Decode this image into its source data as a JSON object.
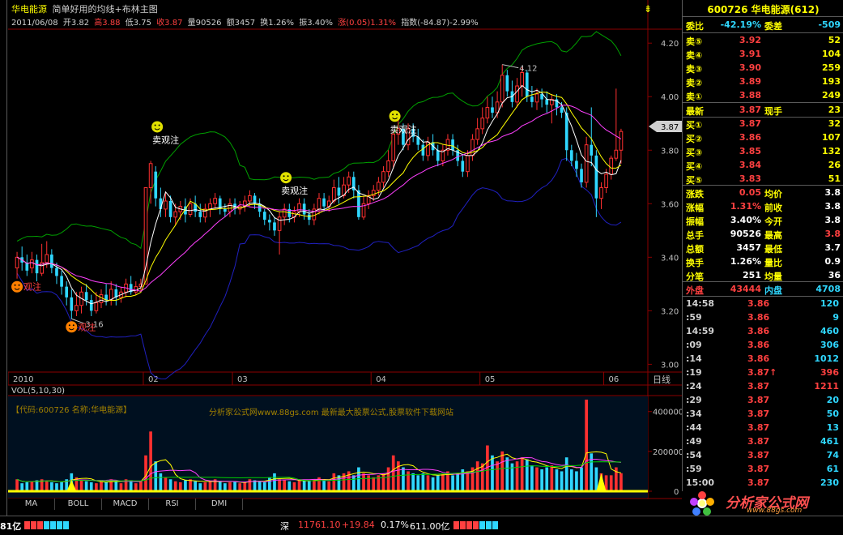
{
  "header": {
    "stock_name": "华电能源",
    "formula_name": "简单好用的均线+布林主图",
    "date": "2011/06/08",
    "open": "开3.82",
    "high": "高3.88",
    "low": "低3.75",
    "close": "收3.87",
    "volume": "量90526",
    "amount": "额3457",
    "turnover": "换1.26%",
    "amplitude": "振3.40%",
    "change": "涨(0.05)1.31%",
    "index": "指数(-84.87)-2.99%"
  },
  "price_axis": [
    "4.20",
    "4.00",
    "3.80",
    "3.60",
    "3.40",
    "3.20",
    "3.00"
  ],
  "current_price_tag": "3.87",
  "time_axis": [
    "2010",
    "02",
    "03",
    "04",
    "05",
    "06"
  ],
  "day_label": "日线",
  "annotations": {
    "high_label": "4.12",
    "low_label": "3.16",
    "sell_label": "卖观注",
    "buy_label": "观注"
  },
  "volume_panel": {
    "label": "VOL(5,10,30)",
    "code_line": "【代码:600726 名称:华电能源】",
    "ad_line": "分析家公式网www.88gs.com 最新最大股票公式,股票软件下载网站",
    "axis": [
      "400000",
      "200000",
      "0"
    ]
  },
  "tabs": [
    "MA",
    "BOLL",
    "MACD",
    "RSI",
    "DMI"
  ],
  "status_bar": {
    "left_fragment": "81亿",
    "market": "深",
    "index_value": "11761.10",
    "index_change": "+19.84",
    "index_pct": "0.17%",
    "index_amount": "611.00亿"
  },
  "panel": {
    "title": "600726 华电能源(612)",
    "ratio_label": "委比",
    "ratio_value": "-42.19%",
    "diff_label": "委差",
    "diff_value": "-509",
    "asks": [
      {
        "label": "卖⑤",
        "price": "3.92",
        "vol": "52"
      },
      {
        "label": "卖④",
        "price": "3.91",
        "vol": "104"
      },
      {
        "label": "卖③",
        "price": "3.90",
        "vol": "259"
      },
      {
        "label": "卖②",
        "price": "3.89",
        "vol": "193"
      },
      {
        "label": "卖①",
        "price": "3.88",
        "vol": "249"
      }
    ],
    "last_label": "最新",
    "last_value": "3.87",
    "hand_label": "现手",
    "hand_value": "23",
    "bids": [
      {
        "label": "买①",
        "price": "3.87",
        "vol": "32"
      },
      {
        "label": "买②",
        "price": "3.86",
        "vol": "107"
      },
      {
        "label": "买③",
        "price": "3.85",
        "vol": "132"
      },
      {
        "label": "买④",
        "price": "3.84",
        "vol": "26"
      },
      {
        "label": "买⑤",
        "price": "3.83",
        "vol": "51"
      }
    ],
    "stats": [
      {
        "l1": "涨跌",
        "v1": "0.05",
        "l2": "均价",
        "v2": "3.8"
      },
      {
        "l1": "涨幅",
        "v1": "1.31%",
        "l2": "前收",
        "v2": "3.8"
      },
      {
        "l1": "振幅",
        "v1": "3.40%",
        "l2": "今开",
        "v2": "3.8"
      },
      {
        "l1": "总手",
        "v1": "90526",
        "l2": "最高",
        "v2": "3.8"
      },
      {
        "l1": "总额",
        "v1": "3457",
        "l2": "最低",
        "v2": "3.7"
      },
      {
        "l1": "换手",
        "v1": "1.26%",
        "l2": "量比",
        "v2": "0.9"
      },
      {
        "l1": "分笔",
        "v1": "251",
        "l2": "均量",
        "v2": "36"
      }
    ],
    "outer_label": "外盘",
    "outer_value": "43444",
    "inner_label": "内盘",
    "inner_value": "4708",
    "ticks": [
      {
        "t": "14:58",
        "p": "3.86",
        "v": "120",
        "c": "#2fd7ff"
      },
      {
        "t": ":59",
        "p": "3.86",
        "v": "9",
        "c": "#2fd7ff"
      },
      {
        "t": "14:59",
        "p": "3.86",
        "v": "460",
        "c": "#2fd7ff"
      },
      {
        "t": ":09",
        "p": "3.86",
        "v": "306",
        "c": "#2fd7ff"
      },
      {
        "t": ":14",
        "p": "3.86",
        "v": "1012",
        "c": "#2fd7ff"
      },
      {
        "t": ":19",
        "p": "3.87↑",
        "v": "396",
        "c": "#ff4040"
      },
      {
        "t": ":24",
        "p": "3.87",
        "v": "1211",
        "c": "#ff4040"
      },
      {
        "t": ":29",
        "p": "3.87",
        "v": "20",
        "c": "#2fd7ff"
      },
      {
        "t": ":34",
        "p": "3.87",
        "v": "50",
        "c": "#2fd7ff"
      },
      {
        "t": ":44",
        "p": "3.87",
        "v": "13",
        "c": "#2fd7ff"
      },
      {
        "t": ":49",
        "p": "3.87",
        "v": "461",
        "c": "#2fd7ff"
      },
      {
        "t": ":54",
        "p": "3.87",
        "v": "74",
        "c": "#2fd7ff"
      },
      {
        "t": ":59",
        "p": "3.87",
        "v": "61",
        "c": "#2fd7ff"
      },
      {
        "t": "15:00",
        "p": "3.87",
        "v": "230",
        "c": "#2fd7ff"
      }
    ]
  },
  "logo": {
    "text": "分析家公式网",
    "url": "www.88gs.com"
  },
  "chart_data": {
    "type": "candlestick",
    "y_range": [
      2.98,
      4.24
    ],
    "volume_range": [
      0,
      460000
    ],
    "candles": [
      [
        3.36,
        3.4,
        3.42,
        3.32,
        60000
      ],
      [
        3.4,
        3.38,
        3.44,
        3.35,
        40000
      ],
      [
        3.38,
        3.35,
        3.41,
        3.33,
        45000
      ],
      [
        3.36,
        3.39,
        3.42,
        3.34,
        50000
      ],
      [
        3.39,
        3.34,
        3.41,
        3.31,
        55000
      ],
      [
        3.34,
        3.38,
        3.45,
        3.33,
        60000
      ],
      [
        3.38,
        3.41,
        3.46,
        3.36,
        50000
      ],
      [
        3.41,
        3.36,
        3.43,
        3.34,
        45000
      ],
      [
        3.36,
        3.33,
        3.38,
        3.3,
        40000
      ],
      [
        3.33,
        3.29,
        3.35,
        3.26,
        45000
      ],
      [
        3.29,
        3.25,
        3.31,
        3.22,
        60000
      ],
      [
        3.25,
        3.2,
        3.28,
        3.17,
        90000
      ],
      [
        3.2,
        3.22,
        3.27,
        3.18,
        70000
      ],
      [
        3.22,
        3.27,
        3.29,
        3.19,
        55000
      ],
      [
        3.27,
        3.24,
        3.3,
        3.22,
        50000
      ],
      [
        3.24,
        3.2,
        3.26,
        3.18,
        45000
      ],
      [
        3.2,
        3.23,
        3.27,
        3.19,
        40000
      ],
      [
        3.23,
        3.26,
        3.28,
        3.21,
        50000
      ],
      [
        3.26,
        3.24,
        3.3,
        3.22,
        45000
      ],
      [
        3.24,
        3.28,
        3.31,
        3.22,
        60000
      ],
      [
        3.28,
        3.25,
        3.3,
        3.22,
        50000
      ],
      [
        3.25,
        3.27,
        3.29,
        3.23,
        40000
      ],
      [
        3.27,
        3.3,
        3.32,
        3.25,
        60000
      ],
      [
        3.3,
        3.27,
        3.33,
        3.26,
        55000
      ],
      [
        3.27,
        3.29,
        3.31,
        3.26,
        40000
      ],
      [
        3.29,
        3.3,
        3.32,
        3.27,
        50000
      ],
      [
        3.3,
        3.66,
        3.66,
        3.3,
        180000
      ],
      [
        3.66,
        3.75,
        3.76,
        3.6,
        300000
      ],
      [
        3.72,
        3.62,
        3.74,
        3.59,
        150000
      ],
      [
        3.62,
        3.58,
        3.66,
        3.55,
        90000
      ],
      [
        3.58,
        3.61,
        3.64,
        3.55,
        70000
      ],
      [
        3.61,
        3.55,
        3.63,
        3.53,
        60000
      ],
      [
        3.55,
        3.57,
        3.6,
        3.52,
        50000
      ],
      [
        3.57,
        3.59,
        3.61,
        3.54,
        45000
      ],
      [
        3.59,
        3.56,
        3.62,
        3.53,
        55000
      ],
      [
        3.56,
        3.6,
        3.62,
        3.55,
        60000
      ],
      [
        3.6,
        3.57,
        3.63,
        3.55,
        50000
      ],
      [
        3.57,
        3.55,
        3.6,
        3.53,
        40000
      ],
      [
        3.55,
        3.58,
        3.6,
        3.53,
        45000
      ],
      [
        3.58,
        3.6,
        3.62,
        3.55,
        50000
      ],
      [
        3.6,
        3.62,
        3.64,
        3.58,
        60000
      ],
      [
        3.62,
        3.58,
        3.63,
        3.56,
        50000
      ],
      [
        3.58,
        3.57,
        3.6,
        3.55,
        40000
      ],
      [
        3.57,
        3.6,
        3.62,
        3.55,
        45000
      ],
      [
        3.6,
        3.58,
        3.62,
        3.56,
        50000
      ],
      [
        3.58,
        3.59,
        3.61,
        3.56,
        40000
      ],
      [
        3.59,
        3.61,
        3.63,
        3.57,
        45000
      ],
      [
        3.61,
        3.63,
        3.65,
        3.59,
        60000
      ],
      [
        3.63,
        3.6,
        3.64,
        3.58,
        55000
      ],
      [
        3.6,
        3.57,
        3.62,
        3.55,
        50000
      ],
      [
        3.57,
        3.54,
        3.58,
        3.52,
        45000
      ],
      [
        3.54,
        3.53,
        3.56,
        3.5,
        70000
      ],
      [
        3.53,
        3.5,
        3.55,
        3.48,
        90000
      ],
      [
        3.5,
        3.55,
        3.57,
        3.41,
        60000
      ],
      [
        3.55,
        3.58,
        3.6,
        3.52,
        55000
      ],
      [
        3.58,
        3.55,
        3.6,
        3.53,
        50000
      ],
      [
        3.55,
        3.57,
        3.59,
        3.53,
        45000
      ],
      [
        3.57,
        3.6,
        3.62,
        3.55,
        60000
      ],
      [
        3.6,
        3.56,
        3.62,
        3.54,
        55000
      ],
      [
        3.56,
        3.54,
        3.58,
        3.52,
        50000
      ],
      [
        3.54,
        3.58,
        3.6,
        3.52,
        60000
      ],
      [
        3.58,
        3.62,
        3.64,
        3.56,
        70000
      ],
      [
        3.62,
        3.59,
        3.64,
        3.57,
        60000
      ],
      [
        3.59,
        3.61,
        3.63,
        3.57,
        50000
      ],
      [
        3.61,
        3.66,
        3.69,
        3.6,
        90000
      ],
      [
        3.66,
        3.63,
        3.7,
        3.6,
        80000
      ],
      [
        3.63,
        3.67,
        3.7,
        3.62,
        90000
      ],
      [
        3.67,
        3.7,
        3.72,
        3.64,
        100000
      ],
      [
        3.7,
        3.65,
        3.72,
        3.62,
        80000
      ],
      [
        3.65,
        3.55,
        3.67,
        3.54,
        120000
      ],
      [
        3.55,
        3.6,
        3.63,
        3.54,
        90000
      ],
      [
        3.6,
        3.63,
        3.65,
        3.58,
        80000
      ],
      [
        3.63,
        3.65,
        3.67,
        3.61,
        70000
      ],
      [
        3.65,
        3.68,
        3.7,
        3.63,
        80000
      ],
      [
        3.68,
        3.72,
        3.74,
        3.66,
        90000
      ],
      [
        3.72,
        3.76,
        3.8,
        3.7,
        120000
      ],
      [
        3.76,
        3.86,
        3.87,
        3.73,
        180000
      ],
      [
        3.86,
        3.88,
        3.92,
        3.82,
        150000
      ],
      [
        3.88,
        3.82,
        3.9,
        3.8,
        120000
      ],
      [
        3.82,
        3.88,
        3.9,
        3.8,
        100000
      ],
      [
        3.88,
        3.85,
        3.9,
        3.83,
        90000
      ],
      [
        3.85,
        3.82,
        3.88,
        3.8,
        80000
      ],
      [
        3.82,
        3.78,
        3.84,
        3.76,
        90000
      ],
      [
        3.78,
        3.83,
        3.85,
        3.76,
        80000
      ],
      [
        3.83,
        3.8,
        3.86,
        3.78,
        70000
      ],
      [
        3.8,
        3.76,
        3.82,
        3.74,
        80000
      ],
      [
        3.76,
        3.8,
        3.82,
        3.74,
        90000
      ],
      [
        3.8,
        3.84,
        3.86,
        3.78,
        100000
      ],
      [
        3.84,
        3.8,
        3.86,
        3.78,
        80000
      ],
      [
        3.8,
        3.76,
        3.82,
        3.74,
        90000
      ],
      [
        3.76,
        3.72,
        3.78,
        3.7,
        110000
      ],
      [
        3.72,
        3.78,
        3.8,
        3.7,
        100000
      ],
      [
        3.78,
        3.84,
        3.86,
        3.76,
        120000
      ],
      [
        3.84,
        3.88,
        3.92,
        3.82,
        150000
      ],
      [
        3.88,
        3.92,
        3.96,
        3.86,
        140000
      ],
      [
        3.92,
        3.96,
        4.0,
        3.9,
        230000
      ],
      [
        3.96,
        3.94,
        4.0,
        3.92,
        180000
      ],
      [
        3.94,
        3.98,
        4.02,
        3.92,
        150000
      ],
      [
        3.98,
        4.08,
        4.12,
        3.96,
        200000
      ],
      [
        4.08,
        4.02,
        4.1,
        4.0,
        170000
      ],
      [
        4.02,
        3.98,
        4.06,
        3.96,
        140000
      ],
      [
        3.98,
        4.04,
        4.07,
        3.96,
        150000
      ],
      [
        4.04,
        4.09,
        4.11,
        4.0,
        170000
      ],
      [
        4.09,
        4.0,
        4.1,
        3.98,
        160000
      ],
      [
        4.0,
        3.98,
        4.04,
        3.96,
        130000
      ],
      [
        3.98,
        4.01,
        4.03,
        3.95,
        120000
      ],
      [
        4.01,
        3.99,
        4.03,
        3.96,
        110000
      ],
      [
        3.99,
        3.97,
        4.02,
        3.94,
        120000
      ],
      [
        3.97,
        3.99,
        4.01,
        3.9,
        130000
      ],
      [
        3.99,
        3.96,
        4.01,
        3.93,
        110000
      ],
      [
        3.96,
        3.94,
        3.98,
        3.92,
        100000
      ],
      [
        3.94,
        3.8,
        3.96,
        3.76,
        170000
      ],
      [
        3.8,
        3.76,
        3.82,
        3.74,
        110000
      ],
      [
        3.76,
        3.73,
        3.79,
        3.7,
        100000
      ],
      [
        3.73,
        3.68,
        3.75,
        3.66,
        120000
      ],
      [
        3.68,
        3.82,
        3.85,
        3.66,
        460000
      ],
      [
        3.82,
        3.78,
        3.96,
        3.74,
        190000
      ],
      [
        3.78,
        3.62,
        3.8,
        3.55,
        120000
      ],
      [
        3.62,
        3.66,
        3.68,
        3.58,
        90000
      ],
      [
        3.66,
        3.71,
        3.73,
        3.64,
        80000
      ],
      [
        3.71,
        3.77,
        3.78,
        3.69,
        80000
      ],
      [
        3.77,
        3.8,
        4.03,
        3.76,
        120000
      ],
      [
        3.8,
        3.87,
        3.88,
        3.75,
        90526
      ]
    ]
  }
}
